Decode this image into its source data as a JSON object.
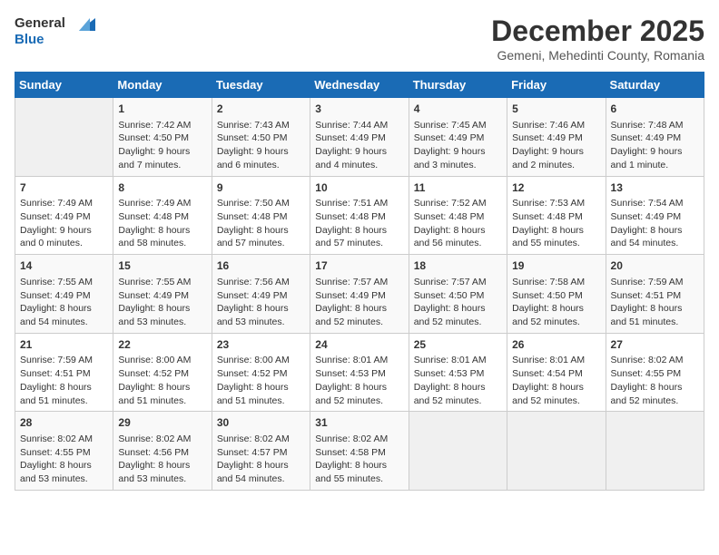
{
  "logo": {
    "line1": "General",
    "line2": "Blue"
  },
  "title": "December 2025",
  "location": "Gemeni, Mehedinti County, Romania",
  "days_of_week": [
    "Sunday",
    "Monday",
    "Tuesday",
    "Wednesday",
    "Thursday",
    "Friday",
    "Saturday"
  ],
  "weeks": [
    [
      {
        "day": "",
        "info": ""
      },
      {
        "day": "1",
        "info": "Sunrise: 7:42 AM\nSunset: 4:50 PM\nDaylight: 9 hours\nand 7 minutes."
      },
      {
        "day": "2",
        "info": "Sunrise: 7:43 AM\nSunset: 4:50 PM\nDaylight: 9 hours\nand 6 minutes."
      },
      {
        "day": "3",
        "info": "Sunrise: 7:44 AM\nSunset: 4:49 PM\nDaylight: 9 hours\nand 4 minutes."
      },
      {
        "day": "4",
        "info": "Sunrise: 7:45 AM\nSunset: 4:49 PM\nDaylight: 9 hours\nand 3 minutes."
      },
      {
        "day": "5",
        "info": "Sunrise: 7:46 AM\nSunset: 4:49 PM\nDaylight: 9 hours\nand 2 minutes."
      },
      {
        "day": "6",
        "info": "Sunrise: 7:48 AM\nSunset: 4:49 PM\nDaylight: 9 hours\nand 1 minute."
      }
    ],
    [
      {
        "day": "7",
        "info": "Sunrise: 7:49 AM\nSunset: 4:49 PM\nDaylight: 9 hours\nand 0 minutes."
      },
      {
        "day": "8",
        "info": "Sunrise: 7:49 AM\nSunset: 4:48 PM\nDaylight: 8 hours\nand 58 minutes."
      },
      {
        "day": "9",
        "info": "Sunrise: 7:50 AM\nSunset: 4:48 PM\nDaylight: 8 hours\nand 57 minutes."
      },
      {
        "day": "10",
        "info": "Sunrise: 7:51 AM\nSunset: 4:48 PM\nDaylight: 8 hours\nand 57 minutes."
      },
      {
        "day": "11",
        "info": "Sunrise: 7:52 AM\nSunset: 4:48 PM\nDaylight: 8 hours\nand 56 minutes."
      },
      {
        "day": "12",
        "info": "Sunrise: 7:53 AM\nSunset: 4:48 PM\nDaylight: 8 hours\nand 55 minutes."
      },
      {
        "day": "13",
        "info": "Sunrise: 7:54 AM\nSunset: 4:49 PM\nDaylight: 8 hours\nand 54 minutes."
      }
    ],
    [
      {
        "day": "14",
        "info": "Sunrise: 7:55 AM\nSunset: 4:49 PM\nDaylight: 8 hours\nand 54 minutes."
      },
      {
        "day": "15",
        "info": "Sunrise: 7:55 AM\nSunset: 4:49 PM\nDaylight: 8 hours\nand 53 minutes."
      },
      {
        "day": "16",
        "info": "Sunrise: 7:56 AM\nSunset: 4:49 PM\nDaylight: 8 hours\nand 53 minutes."
      },
      {
        "day": "17",
        "info": "Sunrise: 7:57 AM\nSunset: 4:49 PM\nDaylight: 8 hours\nand 52 minutes."
      },
      {
        "day": "18",
        "info": "Sunrise: 7:57 AM\nSunset: 4:50 PM\nDaylight: 8 hours\nand 52 minutes."
      },
      {
        "day": "19",
        "info": "Sunrise: 7:58 AM\nSunset: 4:50 PM\nDaylight: 8 hours\nand 52 minutes."
      },
      {
        "day": "20",
        "info": "Sunrise: 7:59 AM\nSunset: 4:51 PM\nDaylight: 8 hours\nand 51 minutes."
      }
    ],
    [
      {
        "day": "21",
        "info": "Sunrise: 7:59 AM\nSunset: 4:51 PM\nDaylight: 8 hours\nand 51 minutes."
      },
      {
        "day": "22",
        "info": "Sunrise: 8:00 AM\nSunset: 4:52 PM\nDaylight: 8 hours\nand 51 minutes."
      },
      {
        "day": "23",
        "info": "Sunrise: 8:00 AM\nSunset: 4:52 PM\nDaylight: 8 hours\nand 51 minutes."
      },
      {
        "day": "24",
        "info": "Sunrise: 8:01 AM\nSunset: 4:53 PM\nDaylight: 8 hours\nand 52 minutes."
      },
      {
        "day": "25",
        "info": "Sunrise: 8:01 AM\nSunset: 4:53 PM\nDaylight: 8 hours\nand 52 minutes."
      },
      {
        "day": "26",
        "info": "Sunrise: 8:01 AM\nSunset: 4:54 PM\nDaylight: 8 hours\nand 52 minutes."
      },
      {
        "day": "27",
        "info": "Sunrise: 8:02 AM\nSunset: 4:55 PM\nDaylight: 8 hours\nand 52 minutes."
      }
    ],
    [
      {
        "day": "28",
        "info": "Sunrise: 8:02 AM\nSunset: 4:55 PM\nDaylight: 8 hours\nand 53 minutes."
      },
      {
        "day": "29",
        "info": "Sunrise: 8:02 AM\nSunset: 4:56 PM\nDaylight: 8 hours\nand 53 minutes."
      },
      {
        "day": "30",
        "info": "Sunrise: 8:02 AM\nSunset: 4:57 PM\nDaylight: 8 hours\nand 54 minutes."
      },
      {
        "day": "31",
        "info": "Sunrise: 8:02 AM\nSunset: 4:58 PM\nDaylight: 8 hours\nand 55 minutes."
      },
      {
        "day": "",
        "info": ""
      },
      {
        "day": "",
        "info": ""
      },
      {
        "day": "",
        "info": ""
      }
    ]
  ]
}
